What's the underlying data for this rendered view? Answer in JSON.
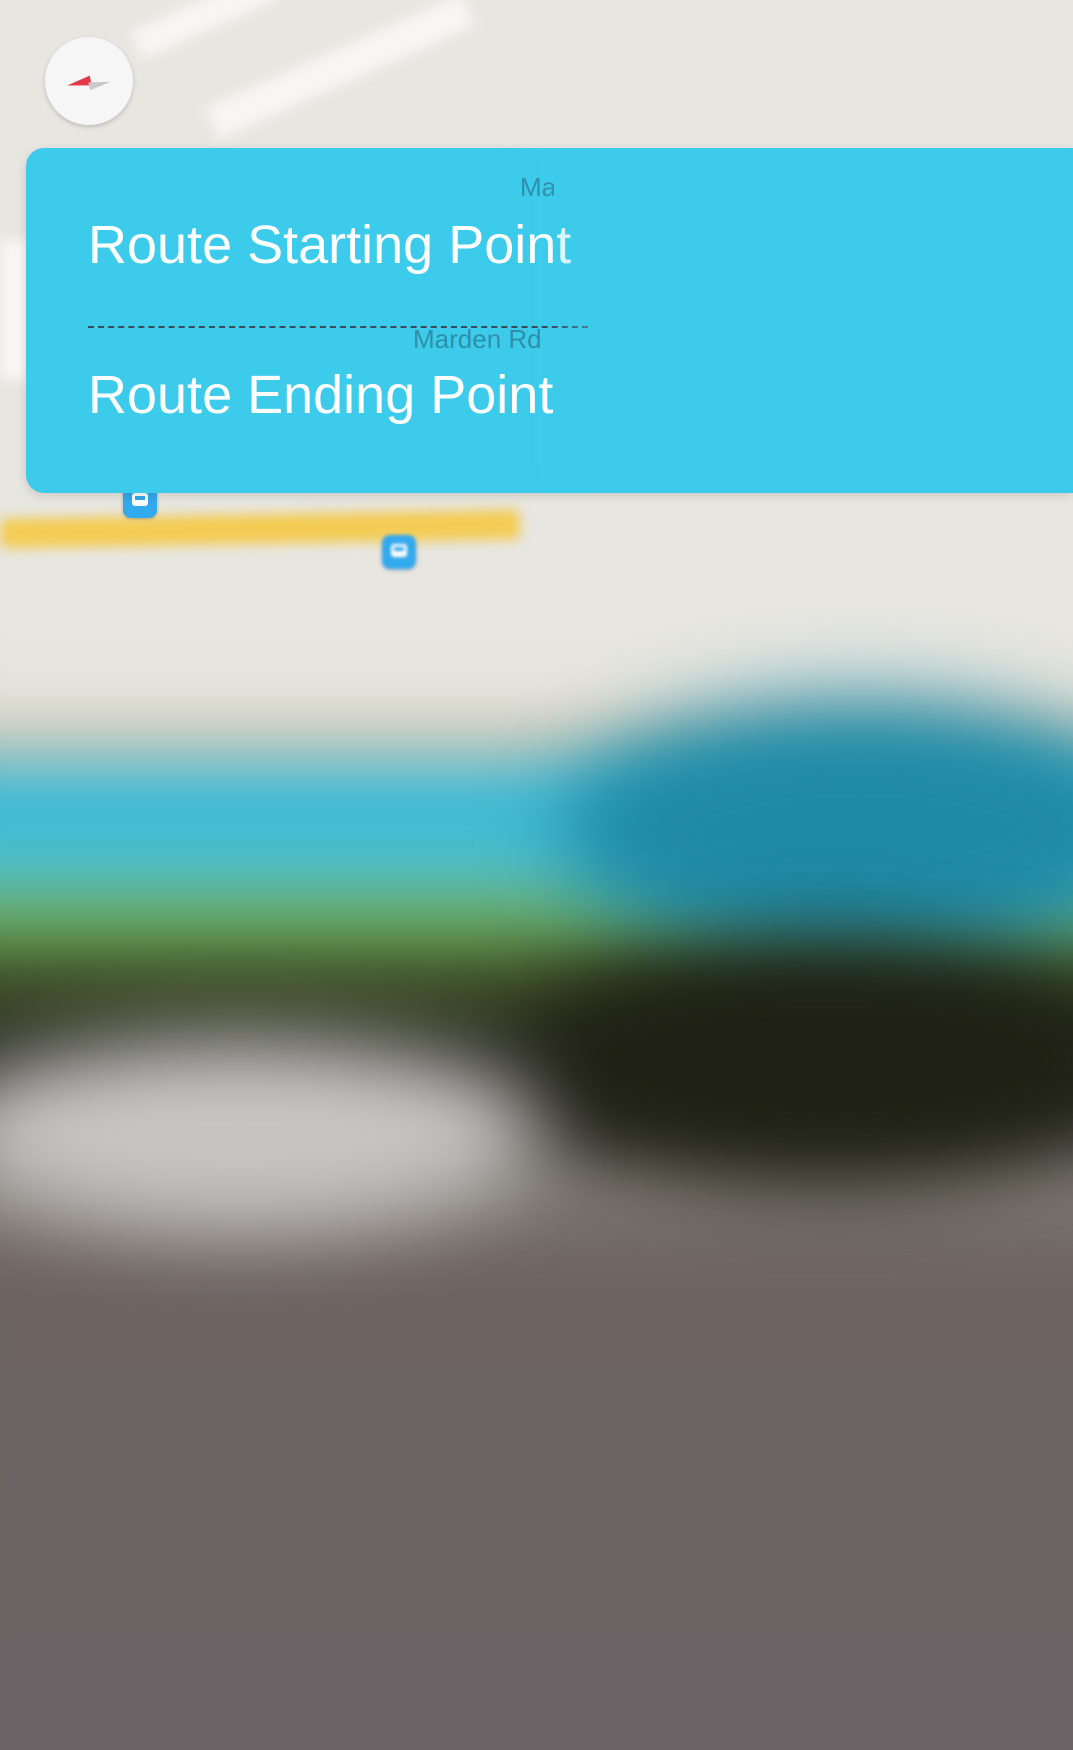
{
  "route": {
    "start_label": "Route Starting Point",
    "end_label": "Route Ending Point"
  },
  "map": {
    "street_top": "Ma",
    "street_mid": "Marden Rd"
  },
  "colors": {
    "card_bg": "#3ccbeb",
    "road_highlight": "#f4cc54",
    "transit_marker": "#33a9ee",
    "compass_needle": "#e1384a"
  },
  "icons": [
    "compass-icon",
    "bus-stop-icon"
  ]
}
